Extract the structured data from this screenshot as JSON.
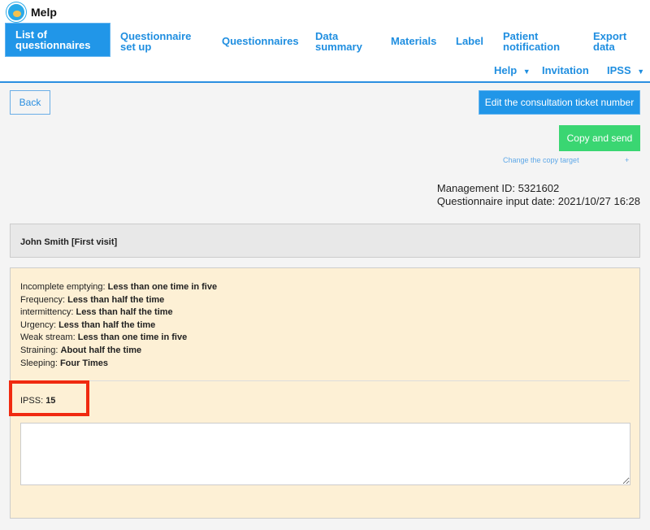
{
  "app": {
    "title": "Melp"
  },
  "nav": {
    "items": [
      "List of questionnaires",
      "Questionnaire set up",
      "Questionnaires",
      "Data summary",
      "Materials",
      "Label",
      "Patient notification",
      "Export data"
    ],
    "secondary": [
      "Help",
      "Invitation",
      "IPSS"
    ]
  },
  "actions": {
    "back": "Back",
    "edit_ticket": "Edit the consultation ticket number",
    "copy_send": "Copy and send",
    "change_target": "Change the copy target",
    "plus": "+"
  },
  "meta": {
    "management_id": "Management ID: 5321602",
    "input_date": "Questionnaire input date: 2021/10/27 16:28"
  },
  "patient": {
    "name": "John Smith [First visit]"
  },
  "answers": [
    {
      "label": "Incomplete emptying: ",
      "value": "Less than one time in five"
    },
    {
      "label": "Frequency: ",
      "value": "Less than half the time"
    },
    {
      "label": "intermittency: ",
      "value": "Less than half the time"
    },
    {
      "label": "Urgency: ",
      "value": "Less than half the time"
    },
    {
      "label": "Weak stream: ",
      "value": "Less than one time in five"
    },
    {
      "label": "Straining: ",
      "value": "About half the time"
    },
    {
      "label": "Sleeping: ",
      "value": "Four Times"
    }
  ],
  "score": {
    "label": "IPSS: ",
    "value": "15"
  },
  "notes": {
    "value": ""
  },
  "colors": {
    "primary": "#2196e8",
    "success": "#3ad672",
    "highlight": "#f02a10",
    "card": "#fdf0d5"
  }
}
